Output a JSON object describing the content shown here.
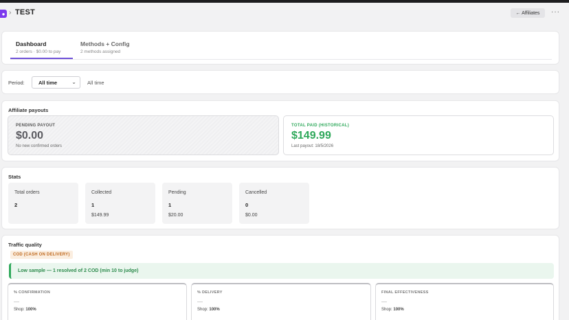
{
  "header": {
    "title": "TEST",
    "affiliates_button": "← Affiliates",
    "more_icon": "more-horizontal-icon"
  },
  "tabs": [
    {
      "label": "Dashboard",
      "sub": "2 orders · $0.00 to pay",
      "active": true
    },
    {
      "label": "Methods + Config",
      "sub": "2 methods assigned",
      "active": false
    }
  ],
  "period": {
    "label": "Period:",
    "selected": "All time",
    "display": "All time"
  },
  "payouts": {
    "title": "Affiliate payouts",
    "pending": {
      "label": "PENDING PAYOUT",
      "amount": "$0.00",
      "note": "No new confirmed orders",
      "color": "#5a5a60"
    },
    "total": {
      "label": "TOTAL PAID (HISTORICAL)",
      "amount": "$149.99",
      "note": "Last payout: 18/5/2026",
      "color": "#2ea85a"
    }
  },
  "stats": {
    "title": "Stats",
    "items": [
      {
        "label": "Total orders",
        "value": "2",
        "amount": ""
      },
      {
        "label": "Collected",
        "value": "1",
        "amount": "$149.99"
      },
      {
        "label": "Pending",
        "value": "1",
        "amount": "$20.00"
      },
      {
        "label": "Cancelled",
        "value": "0",
        "amount": "$0.00"
      }
    ]
  },
  "traffic": {
    "title": "Traffic quality",
    "badge": "COD (CASH ON DELIVERY)",
    "banner": "Low sample — 1 resolved of 2 COD (min 10 to judge)",
    "metrics": [
      {
        "label": "% CONFIRMATION",
        "value": "—",
        "shop_label": "Shop:",
        "shop_value": "100%"
      },
      {
        "label": "% DELIVERY",
        "value": "—",
        "shop_label": "Shop:",
        "shop_value": "100%"
      },
      {
        "label": "FINAL EFFECTIVENESS",
        "value": "—",
        "shop_label": "Shop:",
        "shop_value": "100%"
      }
    ]
  }
}
